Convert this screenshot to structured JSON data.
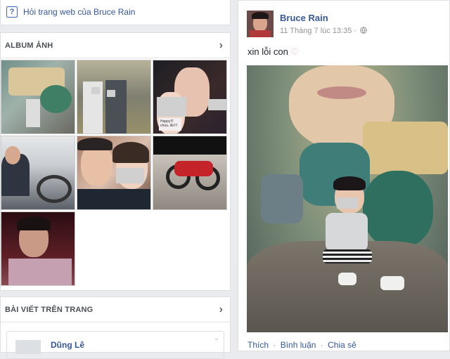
{
  "ask_page": {
    "label": "Hỏi trang web của Bruce Rain",
    "icon": "question-icon"
  },
  "album": {
    "title": "ALBUM ẢNH",
    "photo_captions": [
      "Happy!!! chúa..lắc!!!"
    ]
  },
  "posts_section": {
    "title": "BÀI VIẾT TRÊN TRANG",
    "first_post_author": "Dũng Lê"
  },
  "post": {
    "author": "Bruce Rain",
    "timestamp": "11 Tháng 7 lúc 13:35 ·",
    "audience_icon": "globe-icon",
    "text": "xin lỗi con",
    "emoji": "heart-icon",
    "actions": {
      "like": "Thích",
      "comment": "Bình luận",
      "share": "Chia sẻ"
    },
    "action_separator": "·"
  },
  "colors": {
    "link": "#365899",
    "background": "#e9ebee"
  }
}
